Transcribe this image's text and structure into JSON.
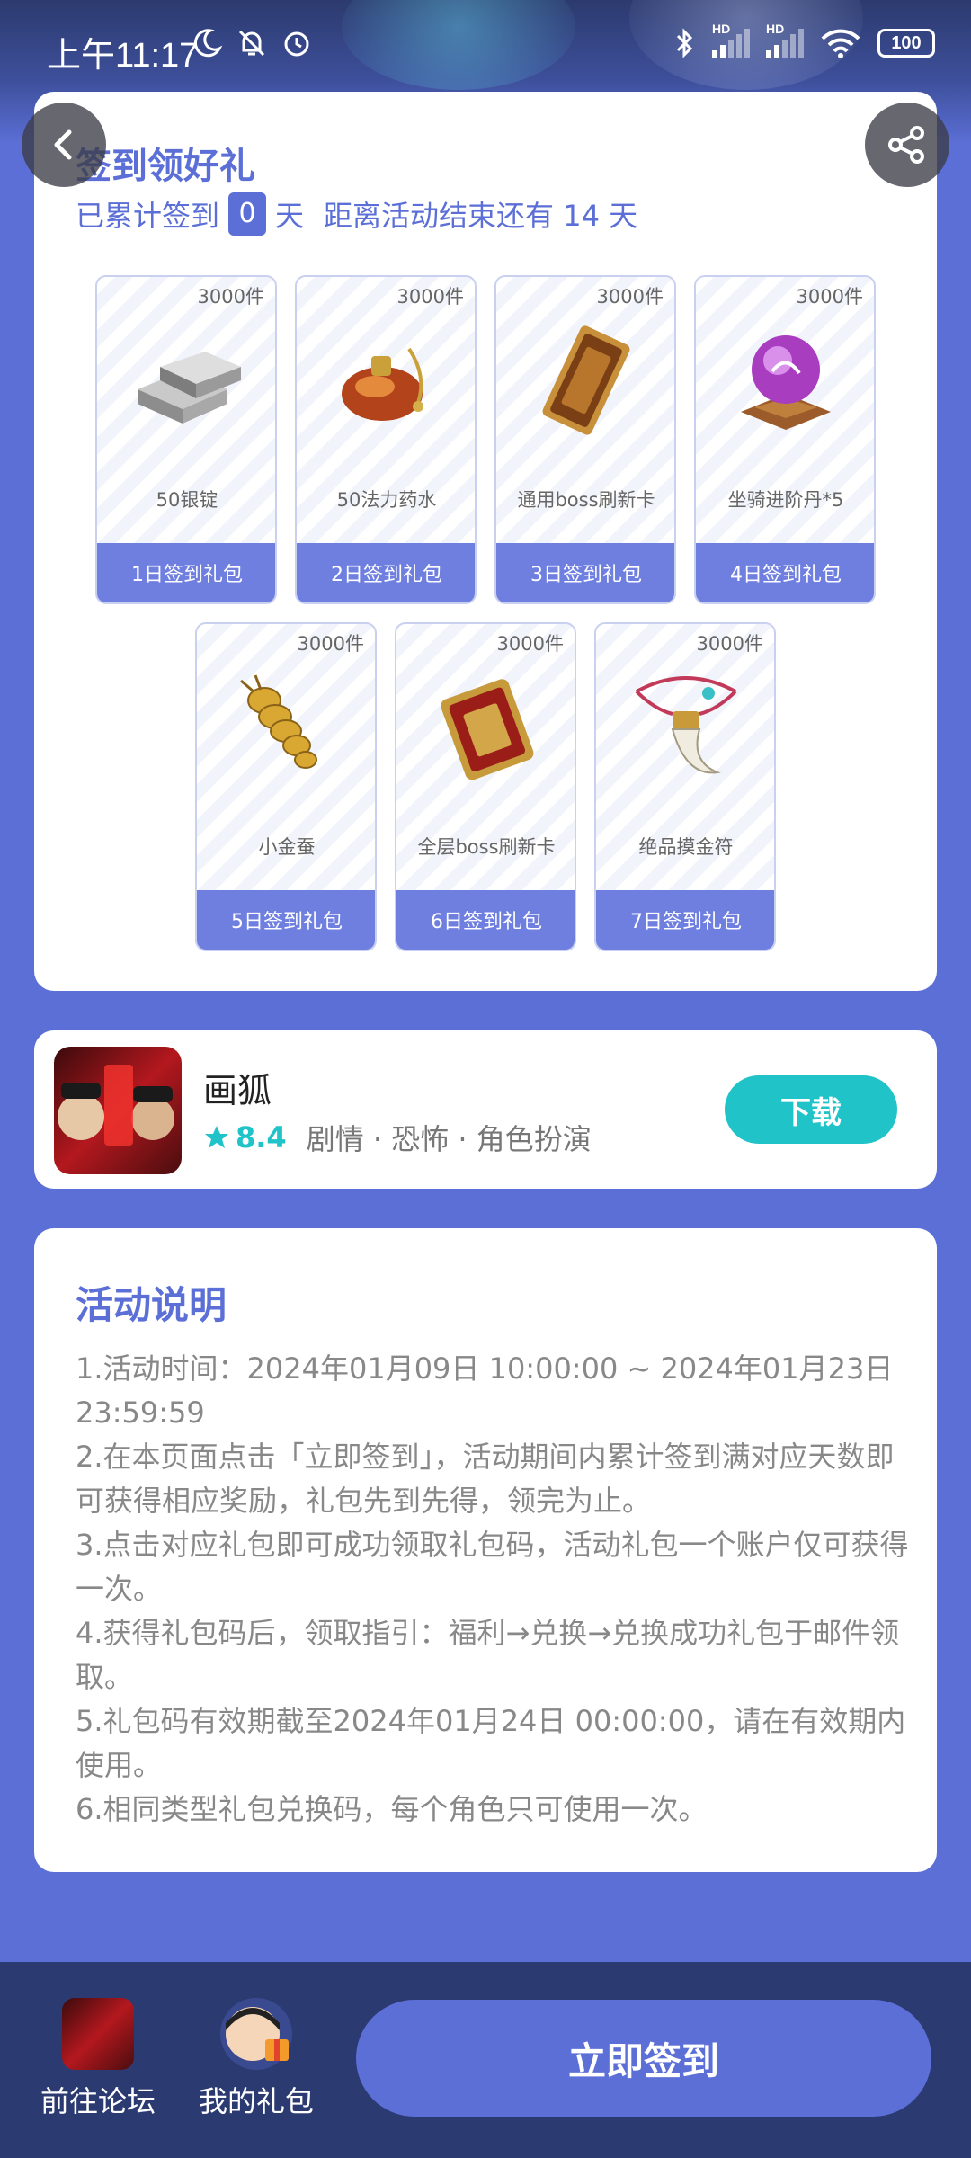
{
  "status_bar": {
    "time": "上午11:17",
    "battery": "100",
    "hd1": "HD",
    "hd2": "HD"
  },
  "signin": {
    "title": "签到领好礼",
    "prefix": "已累计签到",
    "count": "0",
    "day_unit": "天",
    "remaining_text": "距离活动结束还有 14 天",
    "gifts": [
      {
        "stock": "3000件",
        "name": "50银锭",
        "label": "1日签到礼包",
        "icon": "silver-ingot-icon"
      },
      {
        "stock": "3000件",
        "name": "50法力药水",
        "label": "2日签到礼包",
        "icon": "mana-potion-icon"
      },
      {
        "stock": "3000件",
        "name": "通用boss刷新卡",
        "label": "3日签到礼包",
        "icon": "boss-refresh-card-icon"
      },
      {
        "stock": "3000件",
        "name": "坐骑进阶丹*5",
        "label": "4日签到礼包",
        "icon": "mount-pill-icon"
      },
      {
        "stock": "3000件",
        "name": "小金蚕",
        "label": "5日签到礼包",
        "icon": "golden-silkworm-icon"
      },
      {
        "stock": "3000件",
        "name": "全层boss刷新卡",
        "label": "6日签到礼包",
        "icon": "all-floor-boss-card-icon"
      },
      {
        "stock": "3000件",
        "name": "绝品摸金符",
        "label": "7日签到礼包",
        "icon": "gold-amulet-icon"
      }
    ]
  },
  "app": {
    "name": "画狐",
    "rating": "8.4",
    "tags": "剧情 · 恐怖 · 角色扮演",
    "download_label": "下载"
  },
  "rules": {
    "title": "活动说明",
    "items": [
      "1.活动时间：2024年01月09日 10:00:00 ~ 2024年01月23日 23:59:59",
      "2.在本页面点击「立即签到」，活动期间内累计签到满对应天数即可获得相应奖励，礼包先到先得，领完为止。",
      "3.点击对应礼包即可成功领取礼包码，活动礼包一个账户仅可获得一次。",
      "4.获得礼包码后，领取指引：福利→兑换→兑换成功礼包于邮件领取。",
      "5.礼包码有效期截至2024年01月24日 00:00:00，请在有效期内使用。",
      "6.相同类型礼包兑换码，每个角色只可使用一次。"
    ]
  },
  "bottom": {
    "forum_label": "前往论坛",
    "gifts_label": "我的礼包",
    "signin_button": "立即签到"
  },
  "colors": {
    "accent": "#5b6fd6",
    "teal": "#1fc3c8",
    "bottom_bar": "#2c3a72"
  }
}
